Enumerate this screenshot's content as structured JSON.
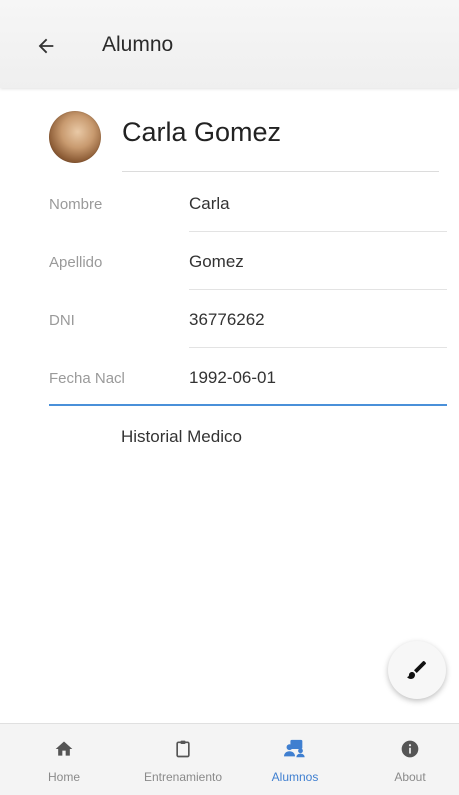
{
  "appbar": {
    "title": "Alumno"
  },
  "student": {
    "full_name": "Carla Gomez"
  },
  "fields": [
    {
      "label": "Nombre",
      "value": "Carla"
    },
    {
      "label": "Apellido",
      "value": "Gomez"
    },
    {
      "label": "DNI",
      "value": "36776262"
    },
    {
      "label": "Fecha Nacl",
      "value": "1992-06-01"
    }
  ],
  "links": {
    "historial": "Historial Medico"
  },
  "icons": {
    "back": "arrow-left-icon",
    "fab": "brush-icon",
    "home": "home-icon",
    "entrenamiento": "clipboard-icon",
    "alumnos": "people-icon",
    "about": "info-icon"
  },
  "bottom_nav": [
    {
      "label": "Home"
    },
    {
      "label": "Entrenamiento"
    },
    {
      "label": "Alumnos"
    },
    {
      "label": "About"
    }
  ],
  "colors": {
    "accent": "#3f7fd0",
    "active_underline": "#4a90d9",
    "label_gray": "#9a9a9a"
  }
}
